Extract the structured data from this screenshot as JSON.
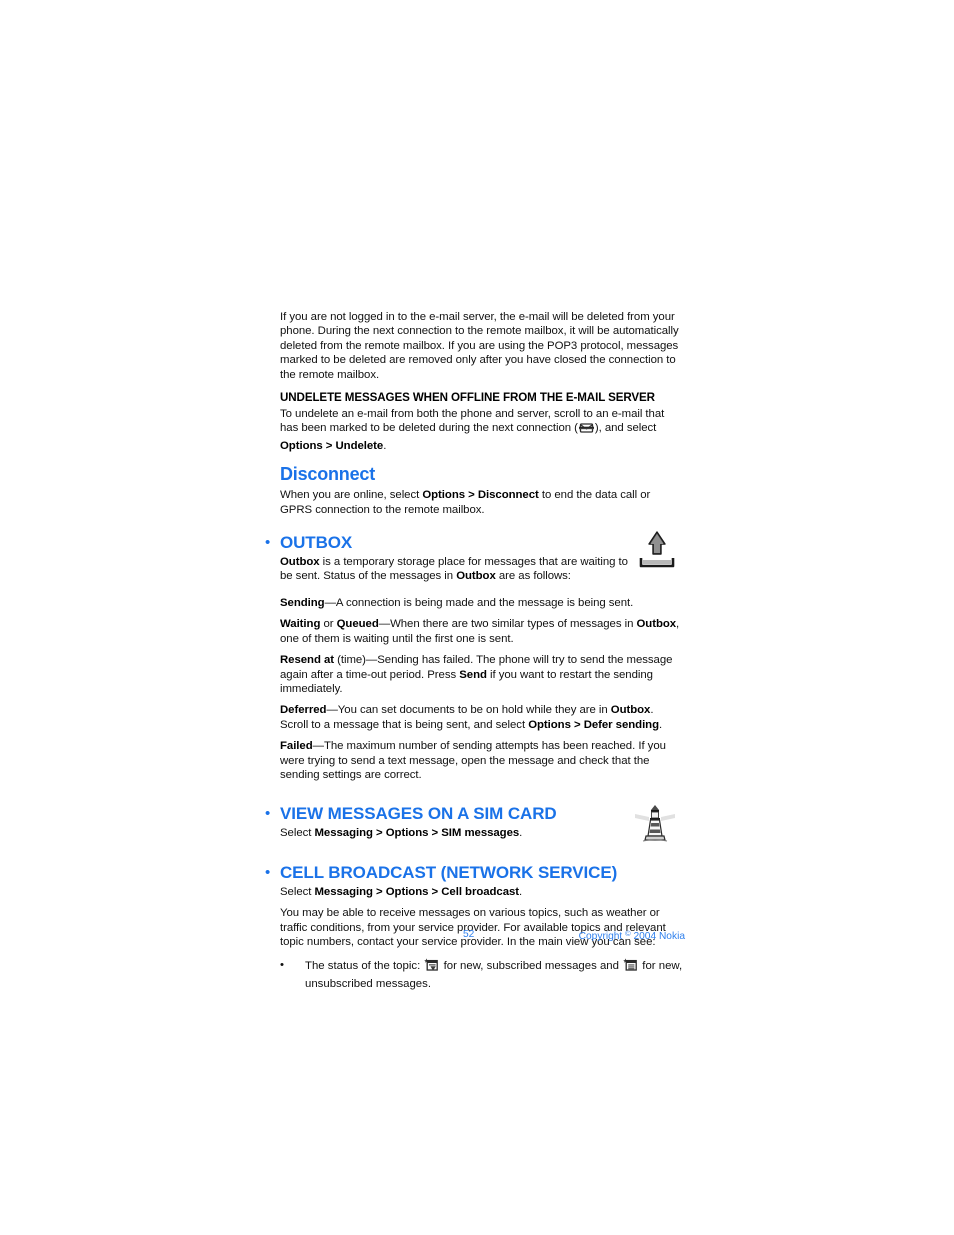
{
  "document": {
    "page_number": "52",
    "copyright_prefix": "Copyright ",
    "copyright_symbol": "©",
    "copyright_suffix": " 2004 Nokia",
    "accent_color": "#1a72e8",
    "footer_color": "#2f80ed"
  },
  "intro": {
    "paragraph": "If you are not logged in to the e-mail server, the e-mail will be deleted from your phone. During the next connection to the remote mailbox, it will be automatically deleted from the remote mailbox. If you are using the POP3 protocol, messages marked to be deleted are removed only after you have closed the connection to the remote mailbox."
  },
  "undelete": {
    "heading": "UNDELETE MESSAGES WHEN OFFLINE FROM THE E-MAIL SERVER",
    "text_part1": "To undelete an e-mail from both the phone and server, scroll to an e-mail that has been marked to be deleted during the next connection (",
    "icon_name": "deleted-mail-icon",
    "text_part2": "), and select ",
    "bold_path": "Options > Undelete",
    "text_part3": "."
  },
  "disconnect": {
    "heading": "Disconnect",
    "text_part1": "When you are online, select ",
    "bold_path": "Options > Disconnect",
    "text_part2": " to end the data call or GPRS connection to the remote mailbox."
  },
  "outbox": {
    "heading": "OUTBOX",
    "bullet": "•",
    "icon_name": "outbox-tray-arrow-icon",
    "intro_bold1": "Outbox",
    "intro_text1": " is a temporary storage place for messages that are waiting to be sent. Status of the messages in ",
    "intro_bold2": "Outbox",
    "intro_text2": " are as follows:",
    "statuses": [
      {
        "label": "Sending",
        "text": "—A connection is being made and the message is being sent."
      },
      {
        "label": "Waiting",
        "label_connector": " or ",
        "label2": "Queued",
        "text": "—When there are two similar types of messages in ",
        "bold_mid": "Outbox",
        "text2": ", one of them is waiting until the first one is sent."
      },
      {
        "label": "Resend at",
        "text": " (time)—Sending has failed. The phone will try to send the message again after a time-out period. Press ",
        "bold_mid": "Send",
        "text2": " if you want to restart the sending immediately."
      },
      {
        "label": "Deferred",
        "text": "—You can set documents to be on hold while they are in ",
        "bold_mid": "Outbox",
        "text2": ". Scroll to a message that is being sent, and select ",
        "bold_end": "Options > Defer sending",
        "text3": "."
      },
      {
        "label": "Failed",
        "text": "—The maximum number of sending attempts has been reached. If you were trying to send a text message, open the message and check that the sending settings are correct."
      }
    ]
  },
  "sim_card": {
    "bullet": "•",
    "heading": "VIEW MESSAGES ON A SIM CARD",
    "text_prefix": "Select ",
    "bold_path": "Messaging > Options > SIM messages",
    "text_suffix": "."
  },
  "cell_broadcast": {
    "bullet": "•",
    "heading": "CELL BROADCAST (NETWORK SERVICE)",
    "icon_name": "lighthouse-icon",
    "select_prefix": "Select ",
    "select_bold": "Messaging > Options > Cell broadcast",
    "select_suffix": ".",
    "paragraph": "You may be able to receive messages on various topics, such as weather or traffic conditions, from your service provider. For available topics and relevant topic numbers, contact your service provider. In the main view you can see:",
    "list": [
      {
        "mark": "•",
        "text_part1": "The status of the topic: ",
        "icon1_name": "topic-new-subscribed-icon",
        "text_part2": " for new, subscribed messages and ",
        "icon2_name": "topic-new-unsubscribed-icon",
        "text_part3": " for new, unsubscribed messages."
      }
    ]
  }
}
